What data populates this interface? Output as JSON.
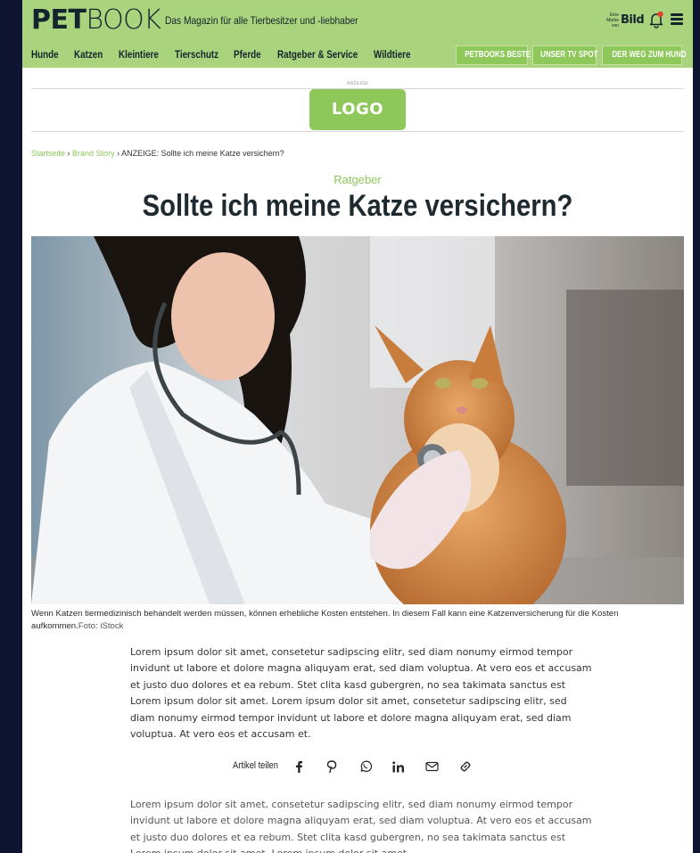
{
  "header": {
    "brand_bold": "PET",
    "brand_light": "BOOK",
    "tagline": "Das Magazin für alle Tierbesitzer und -liebhaber",
    "partner_small": "Eine Marke von",
    "partner_name": "Bild"
  },
  "nav": {
    "items": [
      "Hunde",
      "Katzen",
      "Kleintiere",
      "Tierschutz",
      "Pferde",
      "Ratgeber & Service",
      "Wildtiere"
    ],
    "pills": [
      "PETBOOKS BESTE",
      "UNSER TV SPOT",
      "DER WEG ZUM HUND"
    ]
  },
  "ad": {
    "label": "ANZEIGE",
    "logo_text": "LOGO"
  },
  "breadcrumb": {
    "home": "Startseite",
    "section": "Brand Story",
    "current": "ANZEIGE: Sollte ich meine Katze versichern?"
  },
  "article": {
    "kicker": "Ratgeber",
    "title": "Sollte ich meine Katze versichern?",
    "caption": "Wenn Katzen tiermedizinisch behandelt werden müssen, können erhebliche Kosten entstehen. In diesem Fall kann eine Katzenversicherung für die Kosten aufkommen.",
    "caption_source": "Foto: iStock",
    "para1": "Lorem ipsum dolor sit amet, consetetur sadipscing elitr, sed diam nonumy eirmod tempor invidunt ut labore et dolore magna aliquyam erat, sed diam voluptua. At vero eos et accusam et justo duo dolores et ea rebum. Stet clita kasd gubergren, no sea takimata sanctus est Lorem ipsum dolor sit amet. Lorem ipsum dolor sit amet, consetetur sadipscing elitr, sed diam nonumy eirmod tempor invidunt ut labore et dolore magna aliquyam erat, sed diam voluptua. At vero eos et accusam et.",
    "para2": "Lorem ipsum dolor sit amet, consetetur sadipscing elitr, sed diam nonumy eirmod tempor invidunt ut labore et dolore magna aliquyam erat, sed diam voluptua. At vero eos et accusam et justo duo dolores et ea rebum. Stet clita kasd gubergren, no sea takimata sanctus est Lorem ipsum dolor sit amet. Lorem ipsum dolor sit amet,"
  },
  "share": {
    "label": "Artikel teilen",
    "icons": [
      "facebook-icon",
      "pinterest-icon",
      "whatsapp-icon",
      "linkedin-icon",
      "email-icon",
      "link-icon"
    ]
  },
  "colors": {
    "accent_green": "#8ec85a",
    "header_green": "#a9d37d",
    "text_dark": "#1f2a30",
    "outer_bg": "#0f1430"
  }
}
